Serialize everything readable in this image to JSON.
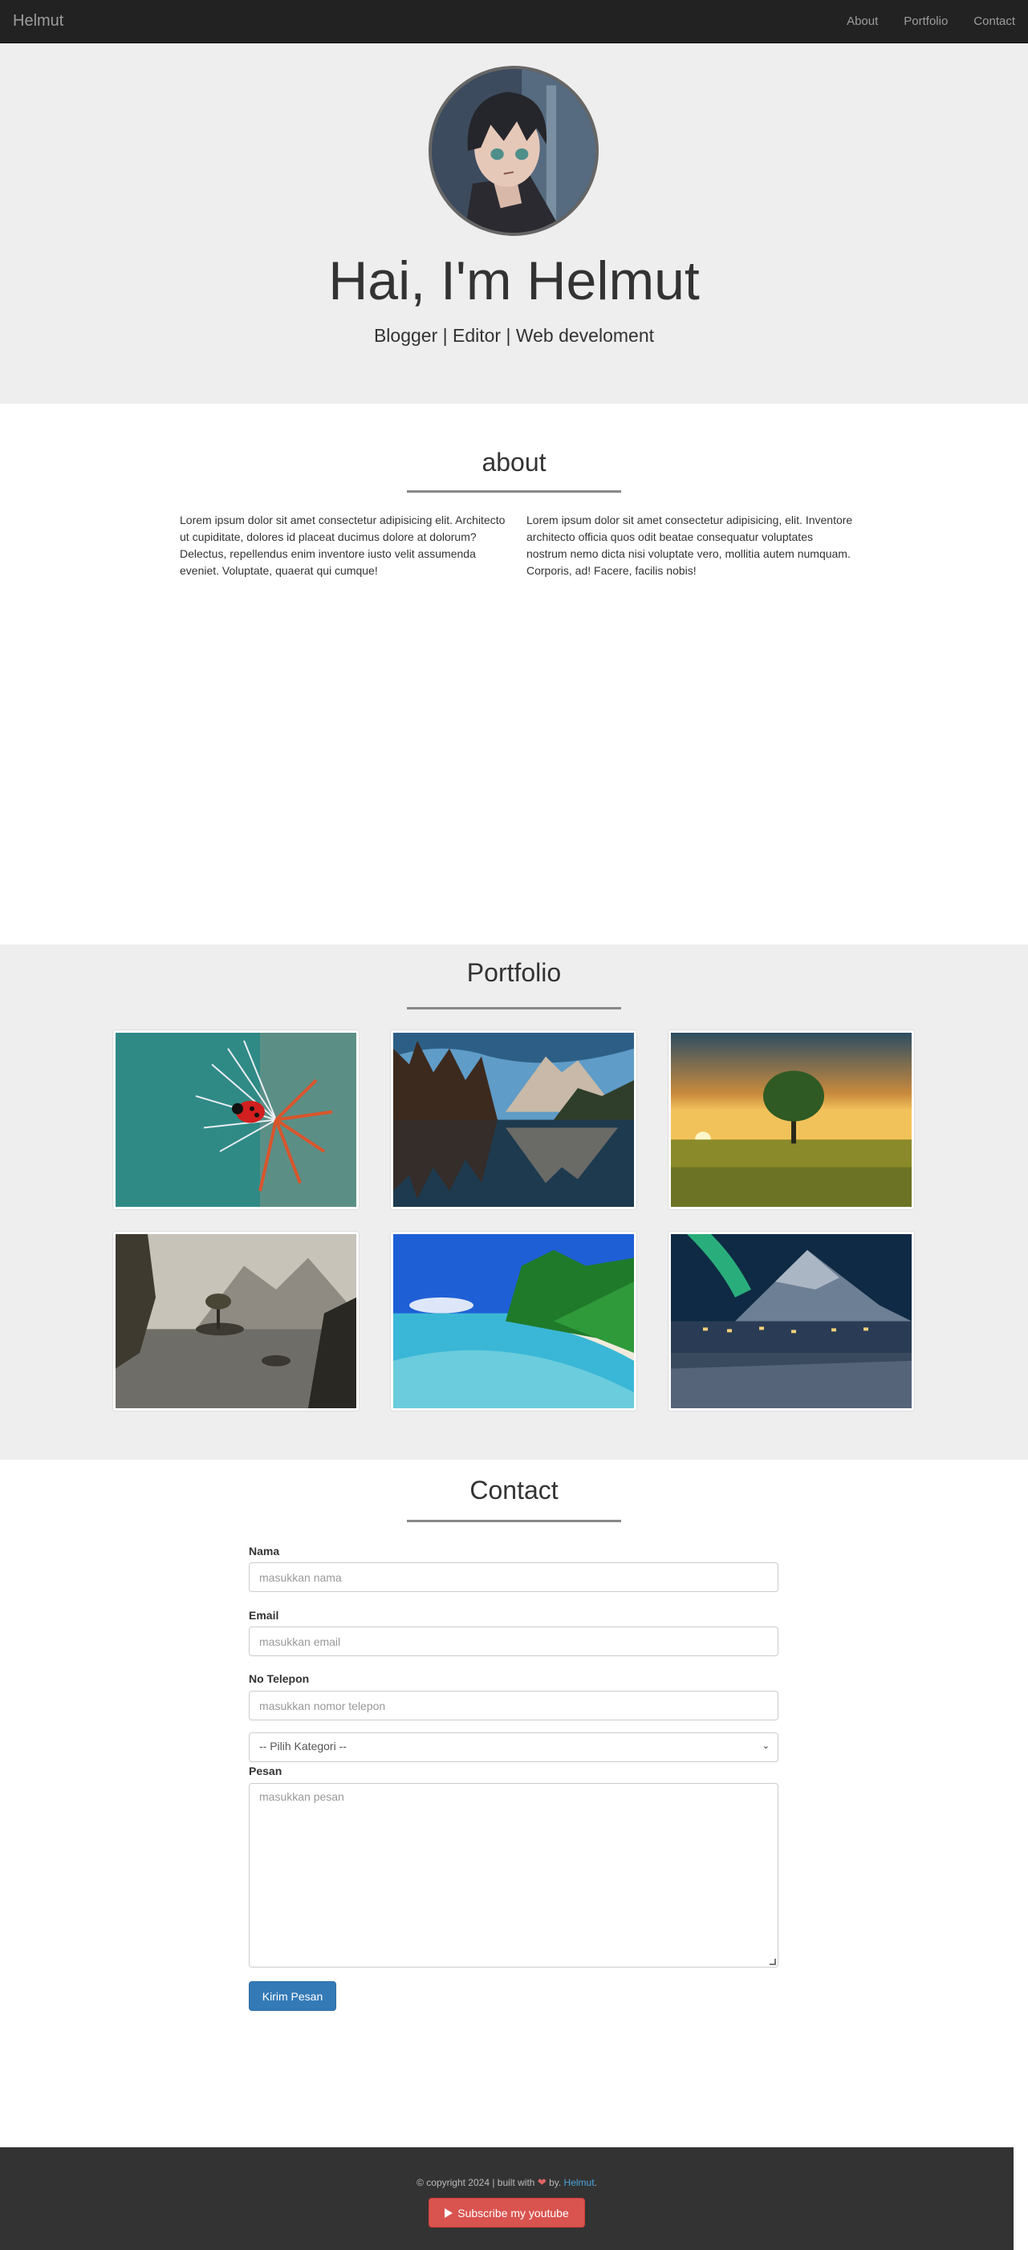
{
  "navbar": {
    "brand": "Helmut",
    "links": [
      "About",
      "Portfolio",
      "Contact"
    ]
  },
  "hero": {
    "title": "Hai, I'm Helmut",
    "subtitle": "Blogger | Editor | Web develoment"
  },
  "about": {
    "title": "about",
    "paragraphs": [
      "Lorem ipsum dolor sit amet consectetur adipisicing elit. Architecto ut cupiditate, dolores id placeat ducimus dolore at dolorum? Delectus, repellendus enim inventore iusto velit assumenda eveniet. Voluptate, quaerat qui cumque!",
      "Lorem ipsum dolor sit amet consectetur adipisicing, elit. Inventore architecto officia quos odit beatae consequatur voluptates nostrum nemo dicta nisi voluptate vero, mollitia autem numquam. Corporis, ad! Facere, facilis nobis!"
    ]
  },
  "portfolio": {
    "title": "Portfolio",
    "images": [
      "ladybug-on-dandelion",
      "mountain-lake-reflection",
      "tree-at-sunset",
      "misty-lake-islands",
      "tropical-beach",
      "aurora-over-village"
    ]
  },
  "contact": {
    "title": "Contact",
    "fields": {
      "name_label": "Nama",
      "name_placeholder": "masukkan nama",
      "email_label": "Email",
      "email_placeholder": "masukkan email",
      "phone_label": "No Telepon",
      "phone_placeholder": "masukkan nomor telepon",
      "category_selected": "-- Pilih Kategori --",
      "message_label": "Pesan",
      "message_placeholder": "masukkan pesan"
    },
    "submit_label": "Kirim Pesan"
  },
  "footer": {
    "text_prefix": "© copyright 2024 | built with",
    "heart_icon": "heart-icon",
    "text_by": "by.",
    "author_link": "Helmut",
    "period": ".",
    "subscribe_label": "Subscribe my youtube"
  },
  "colors": {
    "navbar": "#222222",
    "hero_bg": "#eeeeee",
    "primary": "#337ab7",
    "danger": "#d9534f",
    "footer": "#333333"
  }
}
